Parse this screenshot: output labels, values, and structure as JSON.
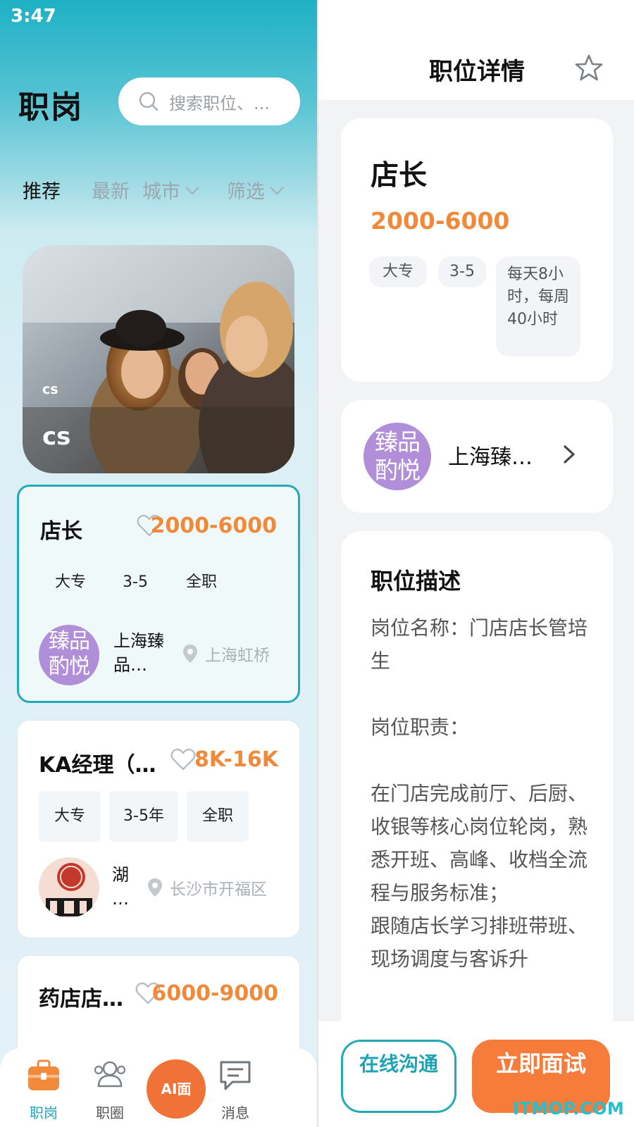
{
  "status_bar": {
    "time": "3:47"
  },
  "jobs_panel": {
    "title": "职岗",
    "search": {
      "placeholder": "搜索职位、..."
    },
    "tabs": [
      {
        "label": "推荐",
        "active": true
      },
      {
        "label": "最新"
      },
      {
        "label": "城市",
        "icon": "chevron-down-icon"
      },
      {
        "label": "筛选",
        "icon": "chevron-down-icon"
      }
    ],
    "banner": {
      "subtitle": "cs",
      "title": "cs"
    },
    "jobs": [
      {
        "title": "店长",
        "salary": "2000-6000",
        "tags": [
          "大专",
          "3-5",
          "全职"
        ],
        "company": "上海臻品…",
        "company_avatar": [
          "臻品",
          "酌悦"
        ],
        "location": "上海虹桥",
        "selected": true
      },
      {
        "title": "KA经理（全...",
        "salary": "8K-16K",
        "tags": [
          "大专",
          "3-5年",
          "全职"
        ],
        "company": "湖\n…",
        "location": "长沙市开福区"
      },
      {
        "title": "药店店...",
        "salary": "6000-9000"
      }
    ]
  },
  "bottom_nav": {
    "items": [
      {
        "label": "职岗",
        "icon": "briefcase-icon",
        "active": true
      },
      {
        "label": "职圈",
        "icon": "people-icon"
      },
      {
        "label": "消息",
        "icon": "message-icon"
      }
    ],
    "ai_button": "AI面"
  },
  "detail_panel": {
    "header_title": "职位详情",
    "job": {
      "title": "店长",
      "salary": "2000-6000",
      "tags": [
        "大专",
        "3-5",
        "每天8小时，每周40小时"
      ]
    },
    "company": {
      "name": "上海臻…",
      "avatar_text": [
        "臻品",
        "酌悦"
      ]
    },
    "description": {
      "title": "职位描述",
      "body": "岗位名称：门店店长管培生\n\n岗位职责：\n\n在门店完成前厅、后厨、收银等核心岗位轮岗，熟悉开班、高峰、收档全流程与服务标准；\n跟随店长学习排班带班、现场调度与客诉升"
    },
    "actions": {
      "chat": "在线沟通",
      "apply": "立即面试"
    }
  },
  "watermark": "ITMOP.COM",
  "colors": {
    "accent": "#1fa4b6",
    "salary": "#f08a3a",
    "apply": "#f57c3a"
  }
}
